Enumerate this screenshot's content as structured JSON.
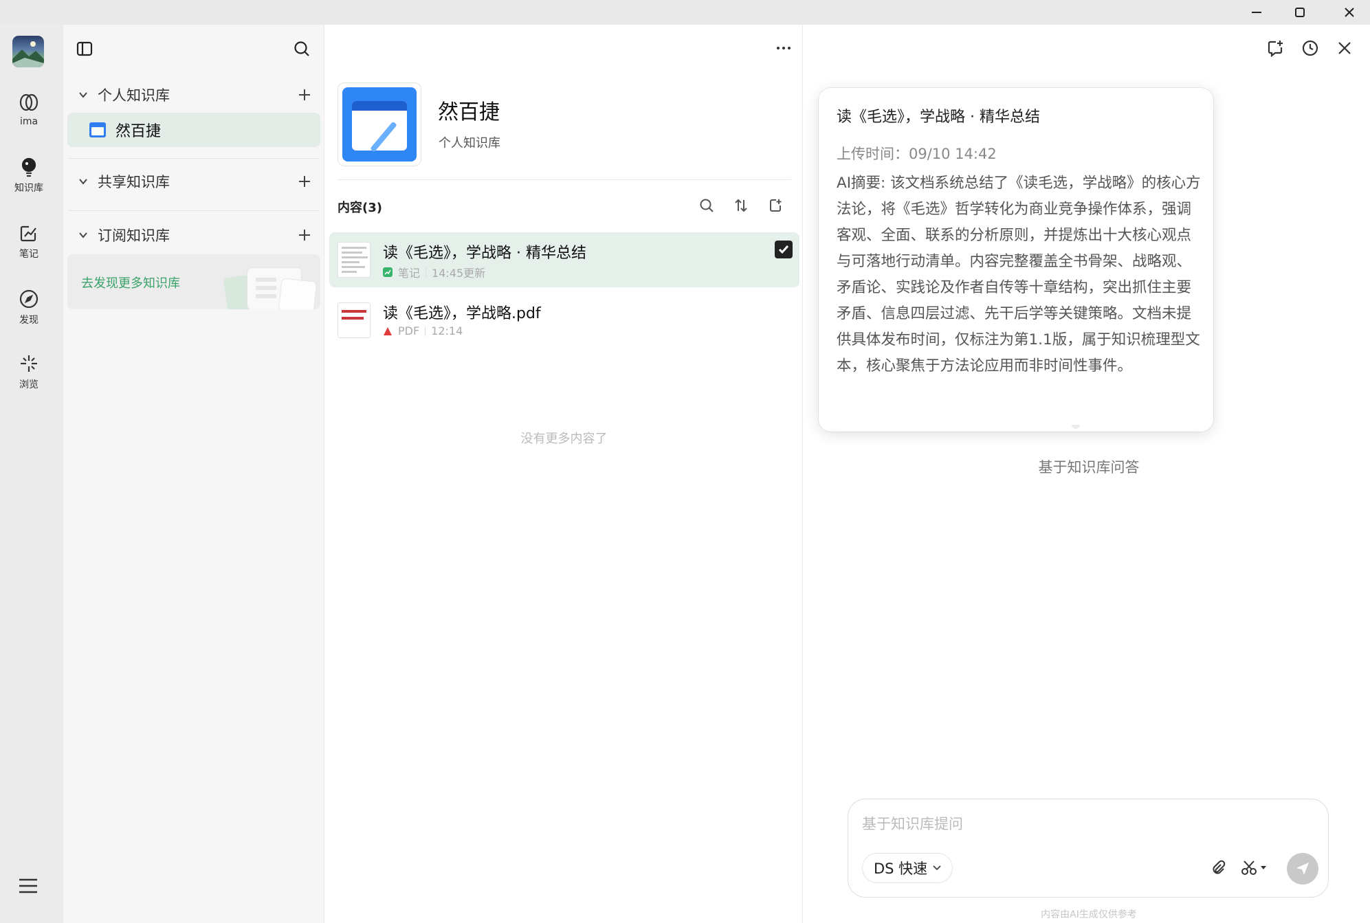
{
  "rail": {
    "items": [
      {
        "label": "ima",
        "icon": "ima-logo-icon"
      },
      {
        "label": "知识库",
        "icon": "bulb-icon"
      },
      {
        "label": "笔记",
        "icon": "note-edit-icon"
      },
      {
        "label": "发现",
        "icon": "compass-icon"
      },
      {
        "label": "浏览",
        "icon": "sparkle-icon"
      }
    ]
  },
  "sidebar": {
    "sections": {
      "personal": "个人知识库",
      "shared": "共享知识库",
      "subscribed": "订阅知识库"
    },
    "kb_item": "然百捷",
    "discover": "去发现更多知识库"
  },
  "main": {
    "kb_title": "然百捷",
    "kb_subtitle": "个人知识库",
    "content_header": "内容(3)",
    "docs": [
      {
        "title": "读《毛选》，学战略 · 精华总结",
        "type": "笔记",
        "time": "14:45更新",
        "selected": true
      },
      {
        "title": "读《毛选》，学战略.pdf",
        "type": "PDF",
        "time": "12:14",
        "selected": false
      }
    ],
    "no_more": "没有更多内容了"
  },
  "summary": {
    "title": "读《毛选》，学战略 · 精华总结",
    "upload_time": "上传时间：09/10 14:42",
    "body": "AI摘要: 该文档系统总结了《读毛选，学战略》的核心方法论，将《毛选》哲学转化为商业竞争操作体系，强调客观、全面、联系的分析原则，并提炼出十大核心观点与可落地行动清单。内容完整覆盖全书骨架、战略观、矛盾论、实践论及作者自传等十章结构，突出抓住主要矛盾、信息四层过滤、先干后学等关键策略。文档未提供具体发布时间，仅标注为第1.1版，属于知识梳理型文本，核心聚焦于方法论应用而非时间性事件。"
  },
  "qa": {
    "label": "基于知识库问答",
    "placeholder": "基于知识库提问",
    "model": "DS 快速",
    "footnote": "内容由AI生成仅供参考"
  },
  "colors": {
    "accent_green": "#3aa36a",
    "selected_row": "#e6f0ea",
    "kb_blue": "#2f86f5",
    "pdf_red": "#e03a3a"
  }
}
